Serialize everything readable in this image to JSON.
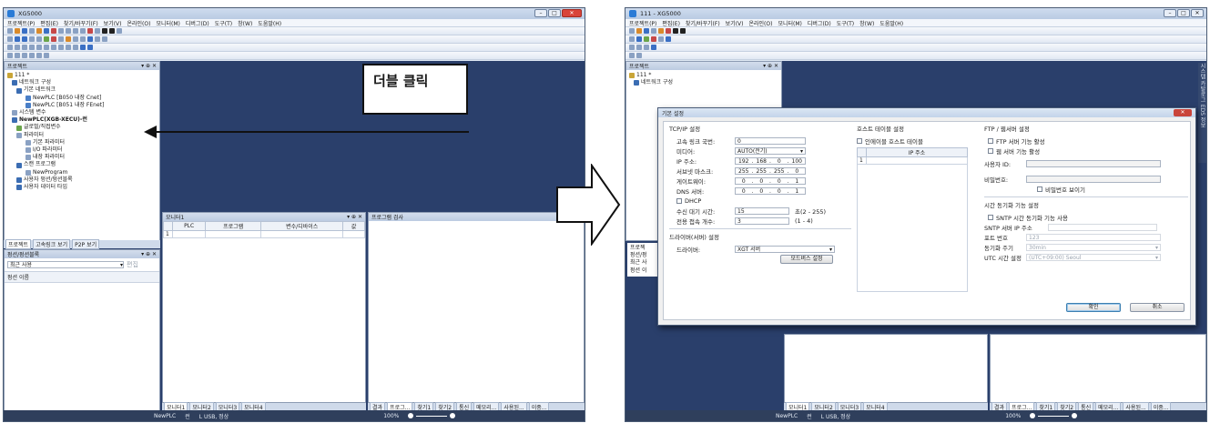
{
  "left": {
    "title": "XG5000",
    "menu": [
      "프로젝트(P)",
      "편집(E)",
      "찾기/바꾸기(F)",
      "보기(V)",
      "온라인(O)",
      "모니터(M)",
      "디버그(D)",
      "도구(T)",
      "창(W)",
      "도움말(H)"
    ],
    "project_panel": {
      "title": "프로젝트",
      "tree": [
        "111 *",
        "네트워크 구성",
        "기본 네트워크",
        "NewPLC [B050 내장 Cnet]",
        "NewPLC [B051 내장 FEnet]",
        "시스템 변수",
        "NewPLC(XGB-XECU)-런",
        "글로벌/직접변수",
        "파라미터",
        "기본 파라미터",
        "I/O 파라미터",
        "내장 파라미터",
        "스캔 프로그램",
        "NewProgram",
        "사용자 펑션/펑션블록",
        "사용자 데이터 타입"
      ],
      "tabs": [
        "프로젝트",
        "고속링크 보기",
        "P2P 보기"
      ]
    },
    "function_panel": {
      "title": "펑션/펑션블록",
      "select": "최근 사용",
      "edit_btn": "편집",
      "column": "펑션 이름"
    },
    "monitor_panel": {
      "title": "모니터1",
      "columns": [
        "PLC",
        "프로그램",
        "변수/디바이스",
        "값"
      ],
      "row1": "1",
      "tabs": [
        "모니터1",
        "모니터2",
        "모니터3",
        "모니터4"
      ]
    },
    "check_panel": {
      "title": "프로그램 검사",
      "tabs": [
        "결과",
        "프로그...",
        "찾기1",
        "찾기2",
        "통신",
        "메모리...",
        "사용된...",
        "이중..."
      ]
    },
    "status": {
      "plc": "NewPLC",
      "mode": "런",
      "conn": "L USB, 정상",
      "zoom": "100%"
    }
  },
  "callout": "더블 클릭",
  "right": {
    "title": "111 - XG5000",
    "menu": [
      "프로젝트(P)",
      "편집(E)",
      "찾기/바꾸기(F)",
      "보기(V)",
      "온라인(O)",
      "모니터(M)",
      "디버그(D)",
      "도구(T)",
      "창(W)",
      "도움말(H)"
    ],
    "project_panel_title": "프로젝트",
    "tree": [
      "111 *",
      "네트워크 구성"
    ],
    "side_tabs": [
      "프로젝",
      "펑션/펑",
      "최근 사",
      "펑션 이"
    ],
    "monitor_tabs": [
      "모니터1",
      "모니터2",
      "모니터3",
      "모니터4"
    ],
    "check_tabs": [
      "결과",
      "프로그...",
      "찾기1",
      "찾기2",
      "통신",
      "메모리...",
      "사용된...",
      "이중..."
    ],
    "status": {
      "plc": "NewPLC",
      "mode": "런",
      "conn": "L USB, 정상",
      "zoom": "100%"
    },
    "vertical_label": "시스템 카탈로그 EDS 정보"
  },
  "dialog": {
    "title": "기본 설정",
    "tcp": {
      "title": "TCP/IP 설정",
      "fast_link_label": "고속 링크 국번:",
      "fast_link_value": "0",
      "media_label": "미디어:",
      "media_value": "AUTO(전기)",
      "ip_label": "IP 주소:",
      "ip": [
        "192",
        "168",
        "0",
        "100"
      ],
      "subnet_label": "서브넷 마스크:",
      "subnet": [
        "255",
        "255",
        "255",
        "0"
      ],
      "gateway_label": "게이트웨이:",
      "gateway": [
        "0",
        "0",
        "0",
        "1"
      ],
      "dns_label": "DNS 서버:",
      "dns": [
        "0",
        "0",
        "0",
        "1"
      ],
      "dhcp": "DHCP",
      "recv_label": "수신 대기 시간:",
      "recv_value": "15",
      "recv_unit": "초(2 - 255)",
      "conn_label": "전용 접속 개수:",
      "conn_value": "3",
      "conn_unit": "(1 - 4)"
    },
    "driver": {
      "title": "드라이버(서버) 설정",
      "label": "드라이버:",
      "value": "XGT 서버",
      "modbus_btn": "모드버스 설정"
    },
    "host": {
      "title": "호스트 테이블 설정",
      "enable": "인에이블 호스트 테이블",
      "col": "IP 주소",
      "row": "1"
    },
    "ftp": {
      "title": "FTP / 웹서버 설정",
      "ftp_enable": "FTP 서버 기능 활성",
      "web_enable": "웹 서버 기능 활성",
      "user_label": "사용자 ID:",
      "pw_label": "비밀번호:",
      "show_pw": "비밀번호 보이기"
    },
    "time": {
      "title": "시간 동기화 기능 설정",
      "sntp_enable": "SNTP 시간 동기화 기능 사용",
      "sntp_ip_label": "SNTP 서버 IP 주소",
      "port_label": "포트 번호",
      "port_value": "123",
      "period_label": "동기화 주기",
      "period_value": "30min",
      "utc_label": "UTC 시간 설정",
      "utc_value": "(UTC+09:00) Seoul"
    },
    "ok": "확인",
    "cancel": "취소"
  }
}
